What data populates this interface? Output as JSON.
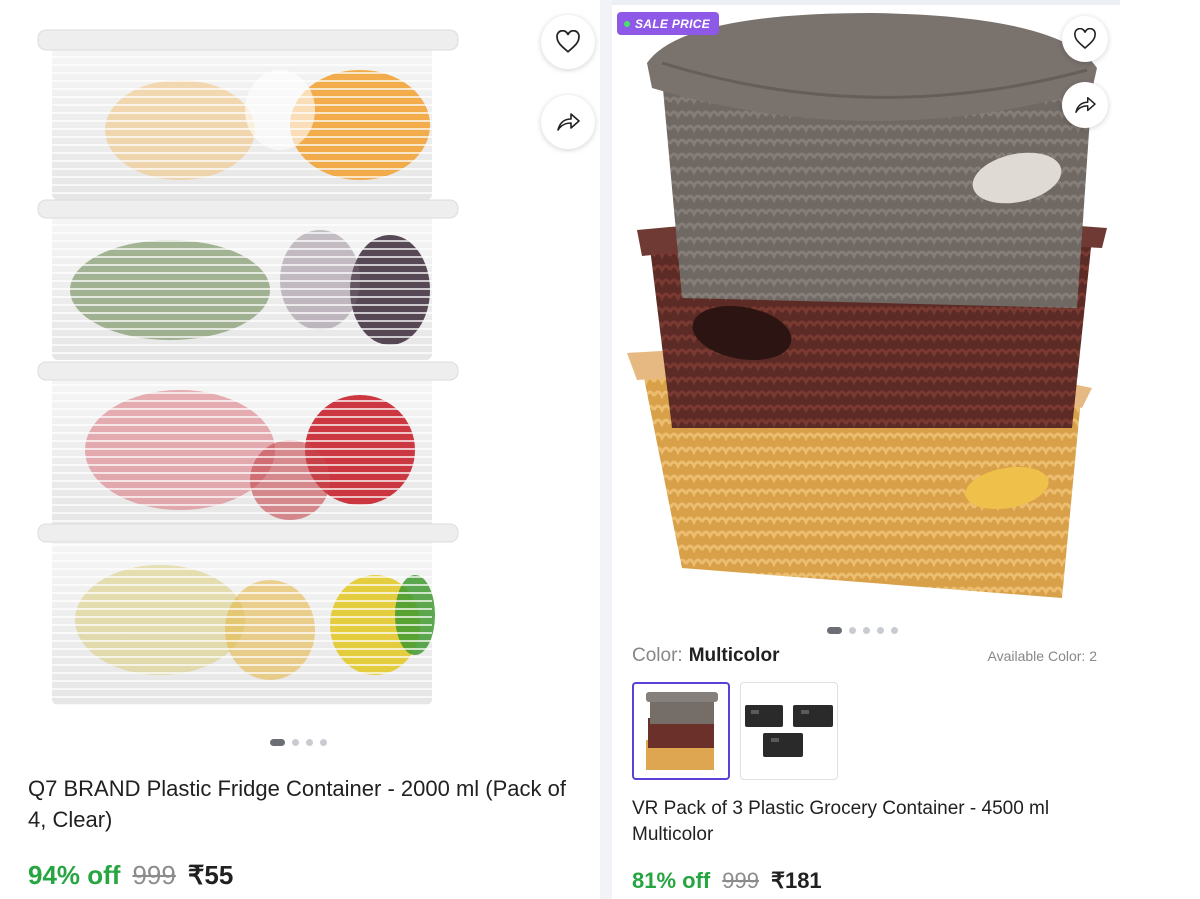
{
  "left_product": {
    "title": "Q7 BRAND Plastic Fridge Container  - 2000 ml (Pack of 4, Clear)",
    "discount": "94% off",
    "mrp": "999",
    "price": "₹55",
    "image_icons": [
      "heart-icon",
      "share-icon"
    ],
    "carousel": {
      "count": 4,
      "active_index": 0
    }
  },
  "right_product": {
    "badge": "SALE PRICE",
    "title": "VR Pack of 3 Plastic Grocery Container  - 4500 ml Multicolor",
    "discount": "81% off",
    "mrp": "999",
    "price": "₹181",
    "color_label": "Color:",
    "color_value": "Multicolor",
    "available_colors": "Available Color: 2",
    "image_icons": [
      "heart-icon",
      "share-icon"
    ],
    "carousel": {
      "count": 5,
      "active_index": 0
    },
    "swatches": [
      {
        "name": "multicolor",
        "selected": true
      },
      {
        "name": "black",
        "selected": false
      }
    ]
  },
  "colors": {
    "discount_green": "#26a541",
    "badge_purple": "#8f59e8",
    "swatch_selected_border": "#5b3fd6"
  }
}
